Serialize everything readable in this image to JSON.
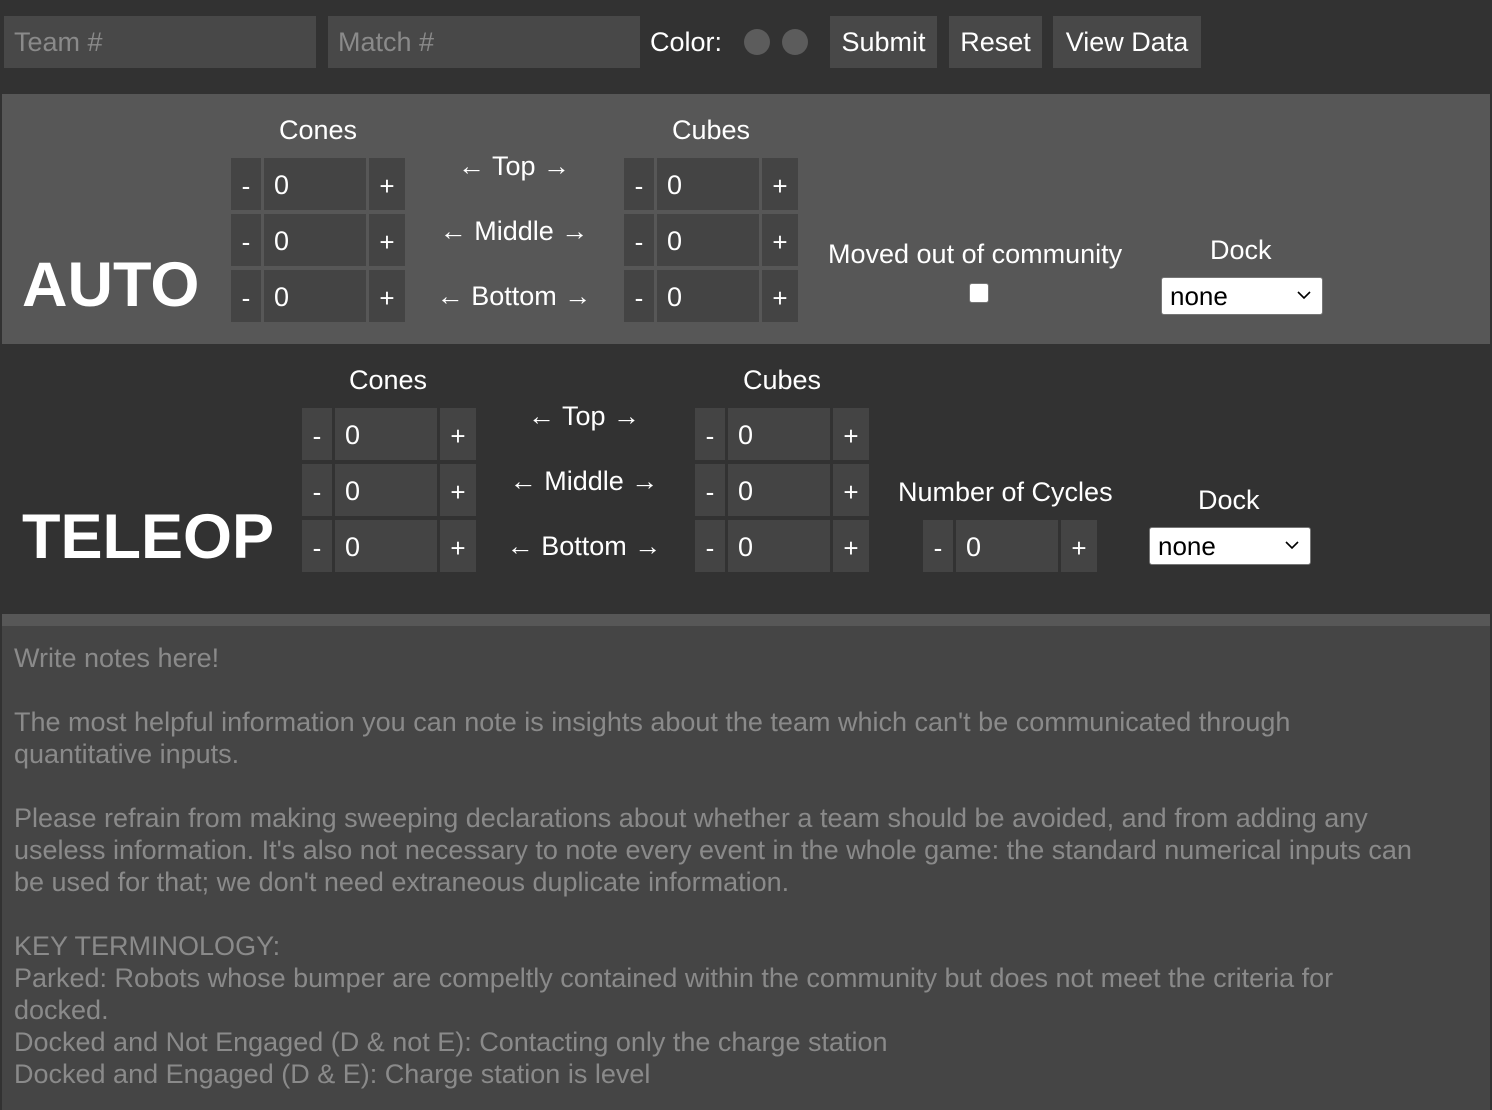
{
  "header": {
    "team_placeholder": "Team #",
    "match_placeholder": "Match #",
    "color_label": "Color:",
    "submit_label": "Submit",
    "reset_label": "Reset",
    "view_data_label": "View Data"
  },
  "auto": {
    "title": "AUTO",
    "cones_header": "Cones",
    "cubes_header": "Cubes",
    "rows": [
      "← Top →",
      "← Middle →",
      "← Bottom →"
    ],
    "cones_values": [
      "0",
      "0",
      "0"
    ],
    "cubes_values": [
      "0",
      "0",
      "0"
    ],
    "moved_label": "Moved out of community",
    "moved_checked": false,
    "dock_label": "Dock",
    "dock_value": "none"
  },
  "teleop": {
    "title": "TELEOP",
    "cones_header": "Cones",
    "cubes_header": "Cubes",
    "rows": [
      "← Top →",
      "← Middle →",
      "← Bottom →"
    ],
    "cones_values": [
      "0",
      "0",
      "0"
    ],
    "cubes_values": [
      "0",
      "0",
      "0"
    ],
    "cycles_label": "Number of Cycles",
    "cycles_value": "0",
    "dock_label": "Dock",
    "dock_value": "none"
  },
  "stepper": {
    "minus": "-",
    "plus": "+"
  },
  "notes": {
    "placeholder": "Write notes here!\n\nThe most helpful information you can note is insights about the team which can't be communicated through\nquantitative inputs.\n\nPlease refrain from making sweeping declarations about whether a team should be avoided, and from adding any\nuseless information. It's also not necessary to note every event in the whole game: the standard numerical inputs can\nbe used for that; we don't need extraneous duplicate information.\n\nKEY TERMINOLOGY:\nParked: Robots whose bumper are compeltly contained within the community but does not meet the criteria for\ndocked.\nDocked and Not Engaged (D & not E): Contacting only the charge station\nDocked and Engaged (D & E): Charge station is level"
  },
  "colors": {
    "page_bg": "#323232",
    "auto_bg": "#575757",
    "input_bg": "#484848",
    "stepper_bg": "#444444",
    "notes_bg": "#454545",
    "placeholder_text": "#8a8a8a"
  }
}
